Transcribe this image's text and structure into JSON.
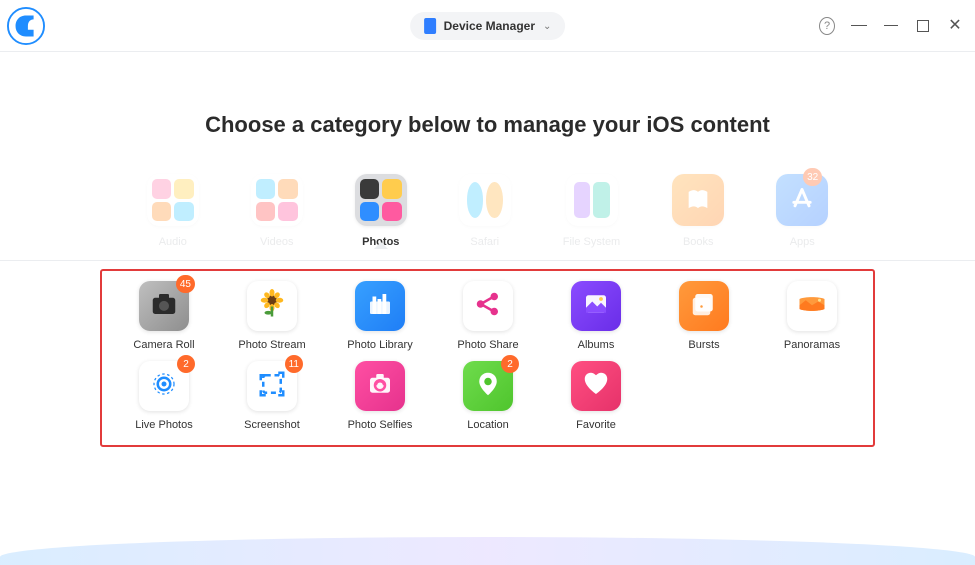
{
  "header": {
    "device_label": "Device Manager"
  },
  "headline": "Choose a category below to manage your iOS content",
  "categories": [
    {
      "label": "Audio",
      "badge": null
    },
    {
      "label": "Videos",
      "badge": null
    },
    {
      "label": "Photos",
      "badge": null
    },
    {
      "label": "Safari",
      "badge": null
    },
    {
      "label": "File System",
      "badge": null
    },
    {
      "label": "Books",
      "badge": null
    },
    {
      "label": "Apps",
      "badge": "32"
    }
  ],
  "subcategories": [
    {
      "label": "Camera Roll",
      "badge": "45",
      "bg": "linear-gradient(135deg,#bfbfbf,#8e8e8e)",
      "icon": "camera"
    },
    {
      "label": "Photo Stream",
      "badge": null,
      "bg": "#fff",
      "icon": "sunflower"
    },
    {
      "label": "Photo Library",
      "badge": null,
      "bg": "linear-gradient(135deg,#37a0ff,#1f7ef6)",
      "icon": "library"
    },
    {
      "label": "Photo Share",
      "badge": null,
      "bg": "#fff",
      "icon": "share"
    },
    {
      "label": "Albums",
      "badge": null,
      "bg": "linear-gradient(135deg,#8a4cff,#6a2de8)",
      "icon": "album"
    },
    {
      "label": "Bursts",
      "badge": null,
      "bg": "linear-gradient(135deg,#ff9a3c,#ff7a1f)",
      "icon": "burst"
    },
    {
      "label": "Panoramas",
      "badge": null,
      "bg": "#fff",
      "icon": "panorama"
    },
    {
      "label": "Live Photos",
      "badge": "2",
      "bg": "#fff",
      "icon": "live"
    },
    {
      "label": "Screenshot",
      "badge": "11",
      "bg": "#fff",
      "icon": "screenshot"
    },
    {
      "label": "Photo Selfies",
      "badge": null,
      "bg": "linear-gradient(135deg,#ff4fa3,#e6328d)",
      "icon": "selfie"
    },
    {
      "label": "Location",
      "badge": "2",
      "bg": "linear-gradient(135deg,#6fdc4d,#4fc52d)",
      "icon": "location"
    },
    {
      "label": "Favorite",
      "badge": null,
      "bg": "linear-gradient(135deg,#ff4f82,#e6326a)",
      "icon": "heart"
    }
  ]
}
